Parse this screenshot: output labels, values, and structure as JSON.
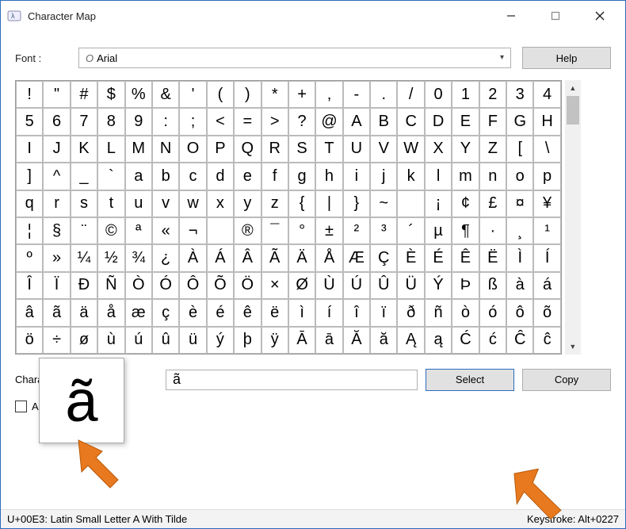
{
  "window": {
    "title": "Character Map"
  },
  "font": {
    "label": "Font :",
    "value": "Arial"
  },
  "help_label": "Help",
  "grid": {
    "rows": [
      [
        "!",
        "\"",
        "#",
        "$",
        "%",
        "&",
        "'",
        "(",
        ")",
        "*",
        "+",
        ",",
        "-",
        ".",
        "/",
        "0",
        "1",
        "2",
        "3",
        "4"
      ],
      [
        "5",
        "6",
        "7",
        "8",
        "9",
        ":",
        ";",
        "<",
        "=",
        ">",
        "?",
        "@",
        "A",
        "B",
        "C",
        "D",
        "E",
        "F",
        "G",
        "H"
      ],
      [
        "I",
        "J",
        "K",
        "L",
        "M",
        "N",
        "O",
        "P",
        "Q",
        "R",
        "S",
        "T",
        "U",
        "V",
        "W",
        "X",
        "Y",
        "Z",
        "[",
        "\\"
      ],
      [
        "]",
        "^",
        "_",
        "`",
        "a",
        "b",
        "c",
        "d",
        "e",
        "f",
        "g",
        "h",
        "i",
        "j",
        "k",
        "l",
        "m",
        "n",
        "o",
        "p"
      ],
      [
        "q",
        "r",
        "s",
        "t",
        "u",
        "v",
        "w",
        "x",
        "y",
        "z",
        "{",
        "|",
        "}",
        "~",
        " ",
        "¡",
        "¢",
        "£",
        "¤",
        "¥"
      ],
      [
        "¦",
        "§",
        "¨",
        "©",
        "ª",
        "«",
        "¬",
        "­",
        "®",
        "¯",
        "°",
        "±",
        "²",
        "³",
        "´",
        "µ",
        "¶",
        "·",
        "¸",
        "¹"
      ],
      [
        "º",
        "»",
        "¼",
        "½",
        "¾",
        "¿",
        "À",
        "Á",
        "Â",
        "Ã",
        "Ä",
        "Å",
        "Æ",
        "Ç",
        "È",
        "É",
        "Ê",
        "Ë",
        "Ì",
        "Í"
      ],
      [
        "Î",
        "Ï",
        "Ð",
        "Ñ",
        "Ò",
        "Ó",
        "Ô",
        "Õ",
        "Ö",
        "×",
        "Ø",
        "Ù",
        "Ú",
        "Û",
        "Ü",
        "Ý",
        "Þ",
        "ß",
        "à",
        "á"
      ],
      [
        "â",
        "ã",
        "ä",
        "å",
        "æ",
        "ç",
        "è",
        "é",
        "ê",
        "ë",
        "ì",
        "í",
        "î",
        "ï",
        "ð",
        "ñ",
        "ò",
        "ó",
        "ô",
        "õ"
      ],
      [
        "ö",
        "÷",
        "ø",
        "ù",
        "ú",
        "û",
        "ü",
        "ý",
        "þ",
        "ÿ",
        "Ā",
        "ā",
        "Ă",
        "ă",
        "Ą",
        "ą",
        "Ć",
        "ć",
        "Ĉ",
        "ĉ"
      ]
    ]
  },
  "preview_char": "ã",
  "copy": {
    "label": "Characters to copy :",
    "value": "ã",
    "select_label": "Select",
    "copy_label": "Copy"
  },
  "advanced_label": "Advanced view",
  "status": {
    "desc": "U+00E3: Latin Small Letter A With Tilde",
    "keystroke": "Keystroke: Alt+0227"
  }
}
